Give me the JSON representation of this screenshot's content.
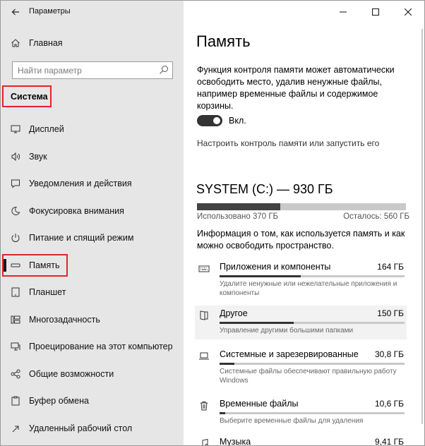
{
  "window": {
    "title": "Параметры"
  },
  "sidebar": {
    "home_label": "Главная",
    "search_placeholder": "Найти параметр",
    "section_title": "Система",
    "items": [
      {
        "label": "Дисплей",
        "icon": "display-icon"
      },
      {
        "label": "Звук",
        "icon": "speaker-icon"
      },
      {
        "label": "Уведомления и действия",
        "icon": "notification-icon"
      },
      {
        "label": "Фокусировка внимания",
        "icon": "moon-icon"
      },
      {
        "label": "Питание и спящий режим",
        "icon": "power-icon"
      },
      {
        "label": "Память",
        "icon": "storage-icon",
        "active": true
      },
      {
        "label": "Планшет",
        "icon": "tablet-icon"
      },
      {
        "label": "Многозадачность",
        "icon": "multitasking-icon"
      },
      {
        "label": "Проецирование на этот компьютер",
        "icon": "projection-icon"
      },
      {
        "label": "Общие возможности",
        "icon": "shared-experiences-icon"
      },
      {
        "label": "Буфер обмена",
        "icon": "clipboard-icon"
      },
      {
        "label": "Удаленный рабочий стол",
        "icon": "remote-desktop-icon"
      }
    ]
  },
  "main": {
    "title": "Память",
    "description": "Функция контроля памяти может автоматически освободить место, удалив ненужные файлы, например временные файлы и содержимое корзины.",
    "toggle": {
      "state": "on",
      "label": "Вкл."
    },
    "configure_link": "Настроить контроль памяти или запустить его",
    "drive": {
      "title": "SYSTEM (C:) — 930 ГБ",
      "used_label": "Использовано 370 ГБ",
      "free_label": "Осталось: 560 ГБ",
      "used_fraction": 0.398
    },
    "info": "Информация о том, как используется память и как можно освободить пространство.",
    "categories": [
      {
        "name": "Приложения и компоненты",
        "size": "164 ГБ",
        "desc": "Удалите ненужные или нежелательные приложения и компоненты",
        "fraction": 0.44,
        "icon": "keyboard-icon"
      },
      {
        "name": "Другое",
        "size": "150 ГБ",
        "desc": "Управление другими большими папками",
        "fraction": 0.4,
        "icon": "folder-icon"
      },
      {
        "name": "Системные и зарезервированные",
        "size": "30,8 ГБ",
        "desc": "Системные файлы обеспечивают правильную работу Windows",
        "fraction": 0.08,
        "icon": "laptop-icon"
      },
      {
        "name": "Временные файлы",
        "size": "10,6 ГБ",
        "desc": "Выберите временные файлы для удаления",
        "fraction": 0.03,
        "icon": "trash-icon"
      },
      {
        "name": "Музыка",
        "size": "9,41 ГБ",
        "desc": "",
        "fraction": 0.025,
        "icon": "music-icon"
      }
    ]
  },
  "colors": {
    "accent": "#333333",
    "highlight": "#e0252a"
  }
}
